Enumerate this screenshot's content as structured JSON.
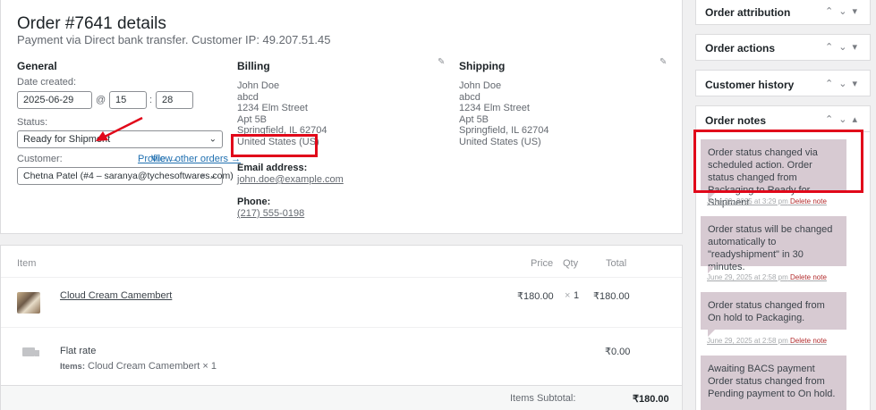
{
  "order": {
    "title": "Order #7641 details",
    "subtitle": "Payment via Direct bank transfer. Customer IP: 49.207.51.45"
  },
  "general": {
    "heading": "General",
    "date_label": "Date created:",
    "date_value": "2025-06-29",
    "at_symbol": "@",
    "hour": "15",
    "minute": "28",
    "time_sep": ":",
    "status_label": "Status:",
    "status_value": "Ready for Shipment",
    "customer_label": "Customer:",
    "profile_link": "Profile →",
    "other_orders_link": "View other orders →",
    "customer_value": "Chetna Patel (#4 – saranya@tychesoftwares.com)",
    "clear_icon": "×"
  },
  "billing": {
    "heading": "Billing",
    "name": "John Doe",
    "company": "abcd",
    "address1": "1234 Elm Street",
    "address2": "Apt 5B",
    "city_line": "Springfield, IL 62704",
    "country": "United States (US)",
    "email_label": "Email address:",
    "email": "john.doe@example.com",
    "phone_label": "Phone:",
    "phone": "(217) 555-0198"
  },
  "shipping": {
    "heading": "Shipping",
    "name": "John Doe",
    "company": "abcd",
    "address1": "1234 Elm Street",
    "address2": "Apt 5B",
    "city_line": "Springfield, IL 62704",
    "country": "United States (US)"
  },
  "items": {
    "col_item": "Item",
    "col_price": "Price",
    "col_qty": "Qty",
    "col_total": "Total",
    "product_name": "Cloud Cream Camembert",
    "product_price": "₹180.00",
    "product_qty_x": "×",
    "product_qty": "1",
    "product_total": "₹180.00",
    "shipping_name": "Flat rate",
    "shipping_items_label": "Items:",
    "shipping_items_value": "Cloud Cream Camembert × 1",
    "shipping_total": "₹0.00",
    "subtotal_label": "Items Subtotal:",
    "subtotal_value": "₹180.00"
  },
  "sidebar": {
    "attribution": "Order attribution",
    "actions": "Order actions",
    "history": "Customer history",
    "notes": "Order notes"
  },
  "notes": [
    {
      "text": "Order status changed via scheduled action. Order status changed from Packaging to Ready for Shipment.",
      "date": "June 29, 2025 at 3:29 pm",
      "delete": "Delete note"
    },
    {
      "text": "Order status will be changed automatically to \"readyshipment\" in 30 minutes.",
      "date": "June 29, 2025 at 2:58 pm",
      "delete": "Delete note"
    },
    {
      "text": "Order status changed from On hold to Packaging.",
      "date": "June 29, 2025 at 2:58 pm",
      "delete": "Delete note"
    },
    {
      "text": "Awaiting BACS payment Order status changed from Pending payment to On hold.",
      "date": "",
      "delete": ""
    }
  ],
  "colors": {
    "highlight": "#e1081a",
    "link": "#2271b1",
    "note_bg": "#d7cad2"
  }
}
